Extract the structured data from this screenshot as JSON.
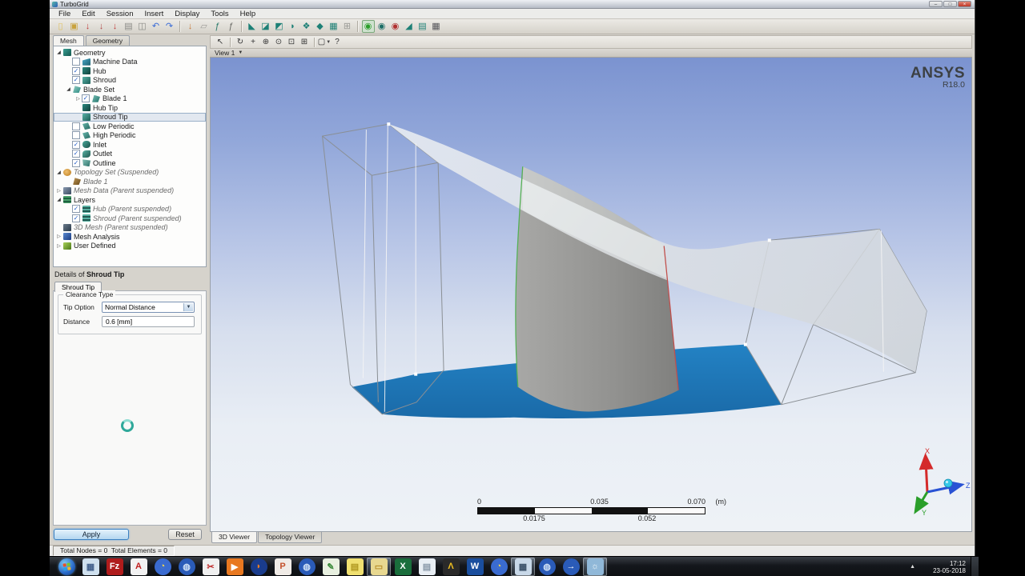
{
  "window": {
    "title": "TurboGrid",
    "min": "–",
    "max": "□",
    "close": "×"
  },
  "menu": {
    "items": [
      "File",
      "Edit",
      "Session",
      "Insert",
      "Display",
      "Tools",
      "Help"
    ]
  },
  "toolbar": {
    "groups": [
      [
        {
          "name": "new-session",
          "glyph": "▯",
          "color": "#e0c060"
        },
        {
          "name": "open-session",
          "glyph": "▣",
          "color": "#c8a23c"
        },
        {
          "name": "save-state",
          "glyph": "↓",
          "color": "#c03838"
        },
        {
          "name": "load-state",
          "glyph": "↓",
          "color": "#b04848"
        },
        {
          "name": "save-state-as",
          "glyph": "↓",
          "color": "#c03838"
        },
        {
          "name": "session-file",
          "glyph": "▤",
          "color": "#8a8a86"
        },
        {
          "name": "snapshot",
          "glyph": "◫",
          "color": "#8a8a86"
        },
        {
          "name": "undo",
          "glyph": "↶",
          "color": "#3a6bd6"
        },
        {
          "name": "redo",
          "glyph": "↷",
          "color": "#3a6bd6"
        }
      ],
      [
        {
          "name": "run-session",
          "glyph": "↓",
          "color": "#c87838"
        },
        {
          "name": "insert-file",
          "glyph": "▱",
          "color": "#9a9a96"
        },
        {
          "name": "calculator-fx",
          "glyph": "ƒ",
          "color": "#2a7a6a"
        },
        {
          "name": "expressions-fx",
          "glyph": "ƒ",
          "color": "#6a6a66"
        }
      ],
      [
        {
          "name": "machine-data-tool",
          "glyph": "◣",
          "color": "#1d8076"
        },
        {
          "name": "hub-tool",
          "glyph": "◪",
          "color": "#1d8076"
        },
        {
          "name": "shroud-tool",
          "glyph": "◩",
          "color": "#1d8076"
        },
        {
          "name": "blade-tool",
          "glyph": "◗",
          "color": "#1d8076"
        },
        {
          "name": "cascade-tool",
          "glyph": "❖",
          "color": "#1d8076"
        },
        {
          "name": "blade-3d-tool",
          "glyph": "◆",
          "color": "#1d8076"
        },
        {
          "name": "layers-tool",
          "glyph": "▦",
          "color": "#1d8076"
        },
        {
          "name": "copy-tool",
          "glyph": "⊞",
          "color": "#9a9a96"
        }
      ],
      [
        {
          "name": "view-all",
          "glyph": "◉",
          "color": "#2a9e2a",
          "pressed": true
        },
        {
          "name": "view-machine",
          "glyph": "◉",
          "color": "#1d6e66"
        },
        {
          "name": "view-component",
          "glyph": "◉",
          "color": "#b03030"
        },
        {
          "name": "blade-view",
          "glyph": "◢",
          "color": "#1d8076"
        },
        {
          "name": "layer-view",
          "glyph": "▤",
          "color": "#1d8076"
        },
        {
          "name": "mesh-view",
          "glyph": "▦",
          "color": "#55555a"
        }
      ]
    ]
  },
  "left_panel": {
    "tabs": [
      {
        "label": "Mesh",
        "active": true
      },
      {
        "label": "Geometry",
        "active": false
      }
    ],
    "tree": [
      {
        "label": "Geometry",
        "depth": 0,
        "expander": "open",
        "checkbox": null,
        "icon": "turbo",
        "italic": false,
        "selected": false
      },
      {
        "label": "Machine Data",
        "depth": 1,
        "expander": null,
        "checkbox": false,
        "icon": "machine",
        "italic": false,
        "selected": false
      },
      {
        "label": "Hub",
        "depth": 1,
        "expander": null,
        "checkbox": true,
        "icon": "hub",
        "italic": false,
        "selected": false
      },
      {
        "label": "Shroud",
        "depth": 1,
        "expander": null,
        "checkbox": true,
        "icon": "shroud",
        "italic": false,
        "selected": false
      },
      {
        "label": "Blade Set",
        "depth": 1,
        "expander": "open",
        "checkbox": null,
        "icon": "bladeset",
        "italic": false,
        "selected": false
      },
      {
        "label": "Blade 1",
        "depth": 2,
        "expander": "closed",
        "checkbox": true,
        "icon": "blade",
        "italic": false,
        "selected": false
      },
      {
        "label": "Hub Tip",
        "depth": 2,
        "expander": null,
        "checkbox": null,
        "icon": "hub",
        "italic": false,
        "selected": false
      },
      {
        "label": "Shroud Tip",
        "depth": 2,
        "expander": null,
        "checkbox": null,
        "icon": "shroud",
        "italic": false,
        "selected": true
      },
      {
        "label": "Low Periodic",
        "depth": 1,
        "expander": null,
        "checkbox": false,
        "icon": "periodic",
        "italic": false,
        "selected": false
      },
      {
        "label": "High Periodic",
        "depth": 1,
        "expander": null,
        "checkbox": false,
        "icon": "periodic",
        "italic": false,
        "selected": false
      },
      {
        "label": "Inlet",
        "depth": 1,
        "expander": null,
        "checkbox": true,
        "icon": "inlet",
        "italic": false,
        "selected": false
      },
      {
        "label": "Outlet",
        "depth": 1,
        "expander": null,
        "checkbox": true,
        "icon": "outlet",
        "italic": false,
        "selected": false
      },
      {
        "label": "Outline",
        "depth": 1,
        "expander": null,
        "checkbox": true,
        "icon": "outline",
        "italic": false,
        "selected": false
      },
      {
        "label": "Topology Set (Suspended)",
        "depth": 0,
        "expander": "open",
        "checkbox": null,
        "icon": "topology",
        "italic": true,
        "selected": false
      },
      {
        "label": "Blade 1",
        "depth": 1,
        "expander": null,
        "checkbox": null,
        "icon": "topoblade",
        "italic": true,
        "selected": false
      },
      {
        "label": "Mesh Data (Parent suspended)",
        "depth": 0,
        "expander": "closed",
        "checkbox": null,
        "icon": "meshdata",
        "italic": true,
        "selected": false
      },
      {
        "label": "Layers",
        "depth": 0,
        "expander": "open",
        "checkbox": null,
        "icon": "layers",
        "italic": false,
        "selected": false
      },
      {
        "label": "Hub (Parent suspended)",
        "depth": 1,
        "expander": null,
        "checkbox": true,
        "icon": "layer",
        "italic": true,
        "selected": false
      },
      {
        "label": "Shroud (Parent suspended)",
        "depth": 1,
        "expander": null,
        "checkbox": true,
        "icon": "layer",
        "italic": true,
        "selected": false
      },
      {
        "label": "3D Mesh (Parent suspended)",
        "depth": 0,
        "expander": null,
        "checkbox": null,
        "icon": "mesh3d",
        "italic": true,
        "selected": false
      },
      {
        "label": "Mesh Analysis",
        "depth": 0,
        "expander": "closed",
        "checkbox": null,
        "icon": "analysis",
        "italic": false,
        "selected": false
      },
      {
        "label": "User Defined",
        "depth": 0,
        "expander": "closed",
        "checkbox": null,
        "icon": "userdef",
        "italic": false,
        "selected": false
      }
    ],
    "details": {
      "title_prefix": "Details of ",
      "title_object": "Shroud Tip",
      "tab_label": "Shroud Tip",
      "group_label": "Clearance Type",
      "tip_option_label": "Tip Option",
      "tip_option_value": "Normal Distance",
      "distance_label": "Distance",
      "distance_value": "0.6 [mm]",
      "apply_label": "Apply",
      "reset_label": "Reset"
    }
  },
  "viewer": {
    "toolbar": [
      {
        "name": "select-cursor",
        "glyph": "↖"
      },
      {
        "name": "rotate",
        "glyph": "↻"
      },
      {
        "name": "pan",
        "glyph": "+"
      },
      {
        "name": "zoom-in",
        "glyph": "⊕"
      },
      {
        "name": "zoom-window",
        "glyph": "⊙"
      },
      {
        "name": "zoom-box",
        "glyph": "⊡"
      },
      {
        "name": "fit-view",
        "glyph": "⊞"
      },
      {
        "name": "render-mode",
        "glyph": "▢",
        "caret": true
      },
      {
        "name": "probe",
        "glyph": "?"
      }
    ],
    "view_label": "View 1",
    "logo_line1": "ANSYS",
    "logo_line2": "R18.0",
    "ruler": {
      "l0": "0",
      "l1": "0.035",
      "l2": "0.070",
      "unit": "(m)",
      "b0": "0.0175",
      "b1": "0.052"
    },
    "axes": {
      "x": "X",
      "y": "Y",
      "z": "Z"
    },
    "tabs": [
      {
        "label": "3D Viewer",
        "active": true
      },
      {
        "label": "Topology Viewer",
        "active": false
      }
    ]
  },
  "status": {
    "text": "Total Nodes = 0  Total Elements = 0"
  },
  "taskbar": {
    "items": [
      {
        "name": "start-button",
        "type": "start"
      },
      {
        "name": "calculator",
        "glyph": "▦",
        "bg": "#cfe0ee",
        "fg": "#44618c"
      },
      {
        "name": "filezilla",
        "glyph": "Fz",
        "bg": "#b01c1c",
        "fg": "#ffffff"
      },
      {
        "name": "acrobat-reader",
        "glyph": "A",
        "bg": "#f2f2f2",
        "fg": "#c02020"
      },
      {
        "name": "browser-globe",
        "glyph": "◔",
        "bg": "#3a6bd0",
        "fg": "#f8d84a",
        "round": true
      },
      {
        "name": "ansys-workbench",
        "glyph": "◍",
        "bg": "#2a5bb8",
        "fg": "#cfe0f5",
        "round": true
      },
      {
        "name": "snipping-tool",
        "glyph": "✂",
        "bg": "#f0f0f0",
        "fg": "#c03030"
      },
      {
        "name": "media-player",
        "glyph": "▶",
        "bg": "#e87820",
        "fg": "#ffffff"
      },
      {
        "name": "firefox",
        "glyph": "◗",
        "bg": "#1a3c8c",
        "fg": "#f08020",
        "round": true
      },
      {
        "name": "powerpoint",
        "glyph": "P",
        "bg": "#f0ebe6",
        "fg": "#c4502a"
      },
      {
        "name": "app-blue",
        "glyph": "◍",
        "bg": "#2a5bb8",
        "fg": "#cfe0f5",
        "round": true
      },
      {
        "name": "notes-editor",
        "glyph": "✎",
        "bg": "#e8f0e0",
        "fg": "#3a8a3a"
      },
      {
        "name": "sticky-notes",
        "glyph": "▤",
        "bg": "#f0e070",
        "fg": "#b09820"
      },
      {
        "name": "windows-explorer",
        "glyph": "▭",
        "bg": "#e8d890",
        "fg": "#b8902c",
        "highlight": true
      },
      {
        "name": "excel",
        "glyph": "X",
        "bg": "#1a6e3c",
        "fg": "#ffffff"
      },
      {
        "name": "notepad",
        "glyph": "▤",
        "bg": "#e8eef4",
        "fg": "#8898a8"
      },
      {
        "name": "ansys-app",
        "glyph": "Λ",
        "bg": "#2a2a2a",
        "fg": "#f0c020"
      },
      {
        "name": "word",
        "glyph": "W",
        "bg": "#1a4e9e",
        "fg": "#ffffff"
      },
      {
        "name": "browser-globe-2",
        "glyph": "◔",
        "bg": "#3a6bd0",
        "fg": "#f8d84a",
        "round": true
      },
      {
        "name": "video-app",
        "glyph": "▦",
        "bg": "#c8d8e8",
        "fg": "#3a5068",
        "highlight": true
      },
      {
        "name": "app-blue-2",
        "glyph": "◍",
        "bg": "#2a5bb8",
        "fg": "#cfe0f5",
        "round": true
      },
      {
        "name": "internet-explorer",
        "glyph": "→",
        "bg": "#2a5bb8",
        "fg": "#ffffff",
        "round": true
      },
      {
        "name": "settings-gear",
        "glyph": "☼",
        "bg": "#90b8d8",
        "fg": "#f0f6fa",
        "highlight": true
      }
    ],
    "tray_time": "17:12",
    "tray_date": "23-05-2018"
  }
}
